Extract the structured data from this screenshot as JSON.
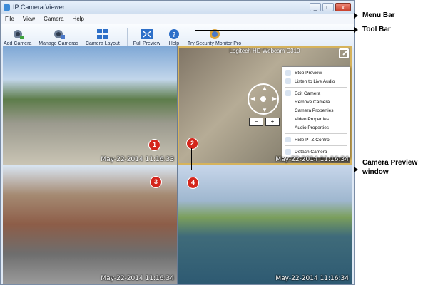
{
  "window": {
    "title": "IP Camera Viewer",
    "controls": [
      "_",
      "□",
      "x"
    ]
  },
  "menu": [
    "File",
    "View",
    "Camera",
    "Help"
  ],
  "toolbar": [
    {
      "label": "Add Camera",
      "icon": "camera-icon"
    },
    {
      "label": "Manage Cameras",
      "icon": "cameras-icon"
    },
    {
      "label": "Camera Layout",
      "icon": "layout-icon"
    },
    {
      "label": "Full Preview",
      "icon": "fullscreen-icon"
    },
    {
      "label": "Help",
      "icon": "help-icon"
    },
    {
      "label": "Try Security Monitor Pro",
      "icon": "globe-icon"
    }
  ],
  "panes": [
    {
      "timestamp": "May-22-2014 11:16:33"
    },
    {
      "title": "Logitech HD Webcam C310",
      "timestamp": "May-22-2014 11:16:34"
    },
    {
      "timestamp": "May-22-2014 11:16:34"
    },
    {
      "timestamp": "May-22-2014 11:16:34"
    }
  ],
  "context_menu": [
    "Stop Preview",
    "Listen to Live Audio",
    "Edit Camera",
    "Remove Camera",
    "Camera Properties",
    "Video Properties",
    "Audio Properties",
    "Hide PTZ Control",
    "Detach Camera"
  ],
  "zoom": {
    "minus": "−",
    "plus": "+"
  },
  "markers": [
    "1",
    "2",
    "3",
    "4"
  ],
  "annotations": {
    "menu_bar": "Menu Bar",
    "tool_bar": "Tool Bar",
    "camera_preview_1": "Camera Preview",
    "camera_preview_2": "window"
  }
}
